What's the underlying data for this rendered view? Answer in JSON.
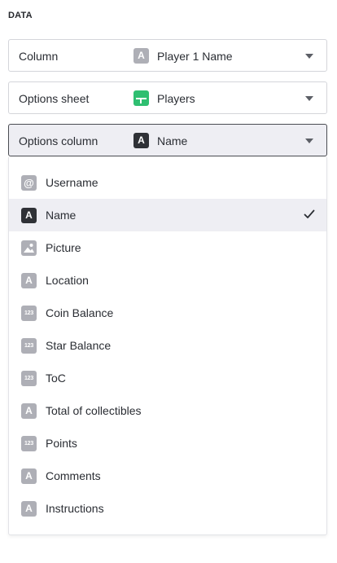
{
  "section": {
    "title": "DATA"
  },
  "fields": {
    "column": {
      "label": "Column",
      "value": "Player 1 Name",
      "icon": "text-type-icon"
    },
    "options_sheet": {
      "label": "Options sheet",
      "value": "Players",
      "icon": "sheet-icon"
    },
    "options_column": {
      "label": "Options column",
      "value": "Name",
      "icon": "text-type-icon"
    }
  },
  "dropdown": {
    "options": [
      {
        "label": "Username",
        "type": "email-icon"
      },
      {
        "label": "Name",
        "type": "text-icon",
        "selected": true
      },
      {
        "label": "Picture",
        "type": "image-icon"
      },
      {
        "label": "Location",
        "type": "text-icon"
      },
      {
        "label": "Coin Balance",
        "type": "number-icon"
      },
      {
        "label": "Star Balance",
        "type": "number-icon"
      },
      {
        "label": "ToC",
        "type": "number-icon"
      },
      {
        "label": "Total of collectibles",
        "type": "text-icon"
      },
      {
        "label": "Points",
        "type": "number-icon"
      },
      {
        "label": "Comments",
        "type": "text-icon"
      },
      {
        "label": "Instructions",
        "type": "text-icon"
      }
    ]
  },
  "glyphs": {
    "text": "A",
    "number": "123",
    "email": "@"
  },
  "colors": {
    "sheet_green": "#2fbf71",
    "type_icon_gray": "#aeafb6",
    "selected_bg": "#eeeef3"
  }
}
